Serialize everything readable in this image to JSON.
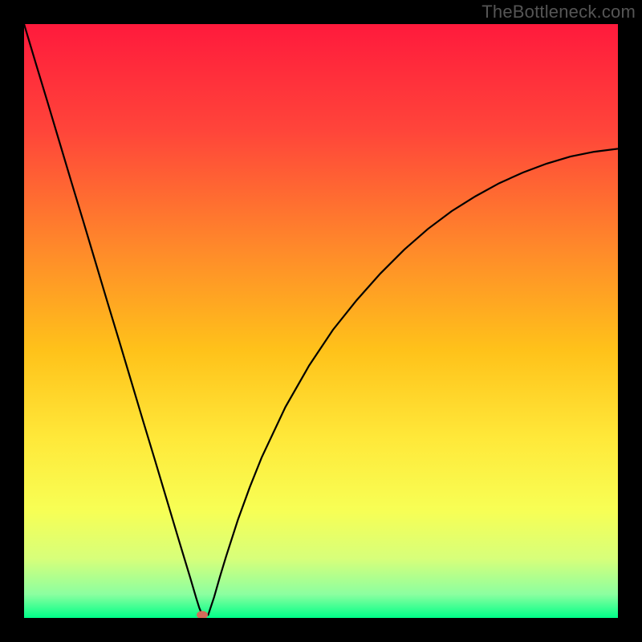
{
  "watermark": "TheBottleneck.com",
  "chart_data": {
    "type": "line",
    "title": "",
    "xlabel": "",
    "ylabel": "",
    "xlim": [
      0,
      100
    ],
    "ylim": [
      0,
      100
    ],
    "grid": false,
    "legend": false,
    "background_gradient": {
      "stops": [
        {
          "pos": 0.0,
          "color": "#ff1a3c"
        },
        {
          "pos": 0.18,
          "color": "#ff453a"
        },
        {
          "pos": 0.38,
          "color": "#ff8a2a"
        },
        {
          "pos": 0.55,
          "color": "#ffc21a"
        },
        {
          "pos": 0.7,
          "color": "#ffe93a"
        },
        {
          "pos": 0.82,
          "color": "#f7ff55"
        },
        {
          "pos": 0.9,
          "color": "#d7ff7a"
        },
        {
          "pos": 0.96,
          "color": "#8cffa0"
        },
        {
          "pos": 1.0,
          "color": "#00ff88"
        }
      ]
    },
    "series": [
      {
        "name": "curve",
        "color": "#000000",
        "x": [
          0.0,
          2.0,
          4.0,
          6.0,
          8.0,
          10.0,
          12.0,
          14.0,
          16.0,
          18.0,
          20.0,
          22.0,
          24.0,
          26.0,
          27.0,
          28.0,
          29.0,
          29.5,
          30.0,
          30.5,
          31.0,
          32.0,
          33.0,
          34.0,
          36.0,
          38.0,
          40.0,
          44.0,
          48.0,
          52.0,
          56.0,
          60.0,
          64.0,
          68.0,
          72.0,
          76.0,
          80.0,
          84.0,
          88.0,
          92.0,
          96.0,
          100.0
        ],
        "y": [
          100.0,
          93.3,
          86.7,
          80.0,
          73.3,
          66.7,
          60.0,
          53.3,
          46.7,
          40.0,
          33.3,
          26.7,
          20.0,
          13.3,
          10.0,
          6.7,
          3.3,
          1.7,
          0.5,
          0.5,
          0.5,
          3.5,
          7.0,
          10.3,
          16.5,
          22.0,
          27.0,
          35.5,
          42.5,
          48.5,
          53.5,
          58.0,
          62.0,
          65.5,
          68.5,
          71.0,
          73.2,
          75.0,
          76.5,
          77.7,
          78.5,
          79.0
        ]
      }
    ],
    "marker": {
      "name": "min-point",
      "x": 30.0,
      "y": 0.5,
      "color": "#d46a5a",
      "rx": 7,
      "ry": 5
    }
  }
}
